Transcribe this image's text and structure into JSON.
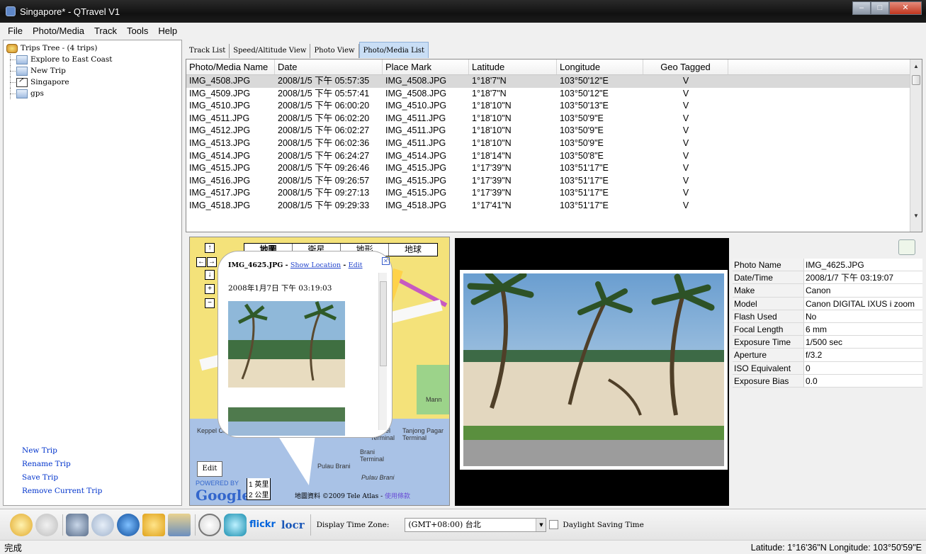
{
  "window": {
    "title": "Singapore* - QTravel V1"
  },
  "menu": [
    "File",
    "Photo/Media",
    "Track",
    "Tools",
    "Help"
  ],
  "tree": {
    "root": "Trips Tree  -  (4 trips)",
    "children": [
      "Explore to East Coast",
      "New Trip",
      "Singapore",
      "gps"
    ]
  },
  "trip_actions": [
    "New Trip",
    "Rename Trip",
    "Save Trip",
    "Remove Current Trip"
  ],
  "tabs": [
    "Track List",
    "Speed/Altitude View",
    "Photo View",
    "Photo/Media List"
  ],
  "table": {
    "columns": [
      "Photo/Media Name",
      "Date",
      "Place Mark",
      "Latitude",
      "Longitude",
      "Geo Tagged"
    ],
    "rows": [
      [
        "IMG_4508.JPG",
        "2008/1/5 下午 05:57:35",
        "IMG_4508.JPG",
        "1°18'7\"N",
        "103°50'12\"E",
        "V"
      ],
      [
        "IMG_4509.JPG",
        "2008/1/5 下午 05:57:41",
        "IMG_4508.JPG",
        "1°18'7\"N",
        "103°50'12\"E",
        "V"
      ],
      [
        "IMG_4510.JPG",
        "2008/1/5 下午 06:00:20",
        "IMG_4510.JPG",
        "1°18'10\"N",
        "103°50'13\"E",
        "V"
      ],
      [
        "IMG_4511.JPG",
        "2008/1/5 下午 06:02:20",
        "IMG_4511.JPG",
        "1°18'10\"N",
        "103°50'9\"E",
        "V"
      ],
      [
        "IMG_4512.JPG",
        "2008/1/5 下午 06:02:27",
        "IMG_4511.JPG",
        "1°18'10\"N",
        "103°50'9\"E",
        "V"
      ],
      [
        "IMG_4513.JPG",
        "2008/1/5 下午 06:02:36",
        "IMG_4511.JPG",
        "1°18'10\"N",
        "103°50'9\"E",
        "V"
      ],
      [
        "IMG_4514.JPG",
        "2008/1/5 下午 06:24:27",
        "IMG_4514.JPG",
        "1°18'14\"N",
        "103°50'8\"E",
        "V"
      ],
      [
        "IMG_4515.JPG",
        "2008/1/5 下午 09:26:46",
        "IMG_4515.JPG",
        "1°17'39\"N",
        "103°51'17\"E",
        "V"
      ],
      [
        "IMG_4516.JPG",
        "2008/1/5 下午 09:26:57",
        "IMG_4515.JPG",
        "1°17'39\"N",
        "103°51'17\"E",
        "V"
      ],
      [
        "IMG_4517.JPG",
        "2008/1/5 下午 09:27:13",
        "IMG_4515.JPG",
        "1°17'39\"N",
        "103°51'17\"E",
        "V"
      ],
      [
        "IMG_4518.JPG",
        "2008/1/5 下午 09:29:33",
        "IMG_4518.JPG",
        "1°17'41\"N",
        "103°51'17\"E",
        "V"
      ]
    ]
  },
  "map": {
    "types": [
      "地圖",
      "衛星",
      "地形",
      "地球"
    ],
    "popup": {
      "file": "IMG_4625.JPG",
      "show_location": "Show Location",
      "edit": "Edit",
      "date": "2008年1月7日 下午 03:19:03"
    },
    "edit_button": "Edit",
    "google_logo_label": "POWERED BY",
    "google_logo": "Google",
    "scale": [
      "1 英里",
      "2 公里"
    ],
    "map_data": "地圖資料",
    "copyright_prefix": "©2009",
    "copyright_tele": "Tele Atlas",
    "copyright_terms": "使用條款",
    "labels": [
      "Keppel Club",
      "Keppel Terminal",
      "Tanjong Pagar Terminal",
      "Brani Terminal",
      "Pulau Brani",
      "Pulau Brani",
      "Mann"
    ]
  },
  "properties": [
    [
      "Photo Name",
      "IMG_4625.JPG"
    ],
    [
      "Date/Time",
      "2008/1/7 下午 03:19:07"
    ],
    [
      "Make",
      "Canon"
    ],
    [
      "Model",
      "Canon DIGITAL IXUS i zoom"
    ],
    [
      "Flash Used",
      "No"
    ],
    [
      "Focal Length",
      "6 mm"
    ],
    [
      "Exposure Time",
      "1/500 sec"
    ],
    [
      "Aperture",
      "f/3.2"
    ],
    [
      "ISO Equivalent",
      "0"
    ],
    [
      "Exposure Bias",
      "0.0"
    ]
  ],
  "toolbar": {
    "flickr": "flickr",
    "locr": "locr",
    "timezone_label": "Display Time Zone:",
    "timezone_value": "(GMT+08:00) 台北",
    "dst_label": "Daylight Saving Time"
  },
  "status": {
    "left": "完成",
    "right": "Latitude: 1°16'36\"N  Longitude: 103°50'59\"E"
  },
  "colors": {
    "selected_tab": "#c9def5",
    "selected_row": "#d9d9d9",
    "title_bar": "#1a1a1a"
  }
}
